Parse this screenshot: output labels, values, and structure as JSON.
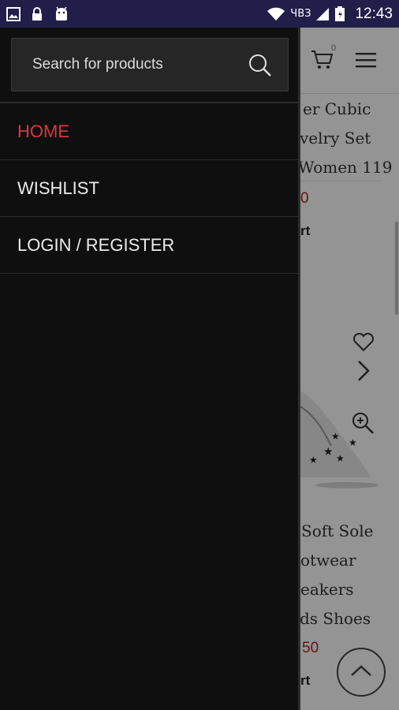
{
  "status_bar": {
    "carrier": "ЧВЗ",
    "time": "12:43",
    "icons": [
      "image-icon",
      "lock-icon",
      "android-icon",
      "wifi-icon",
      "signal-icon",
      "battery-icon"
    ]
  },
  "drawer": {
    "search": {
      "placeholder": "Search for products",
      "value": ""
    },
    "nav": [
      {
        "label": "HOME",
        "active": true
      },
      {
        "label": "WISHLIST",
        "active": false
      },
      {
        "label": "LOGIN / REGISTER",
        "active": false
      }
    ]
  },
  "background": {
    "cart_count": "0",
    "product1_lines": [
      "er Cubic",
      "velry Set",
      "Women 119"
    ],
    "product1_price": "0",
    "product1_cart": "rt",
    "product2_lines": [
      "Soft Sole",
      "otwear",
      "eakers",
      "ds Shoes"
    ],
    "product2_price": "50",
    "product2_cart": "rt"
  },
  "colors": {
    "status_bar": "#221e4a",
    "drawer_bg": "#0f0f0f",
    "active_nav": "#d33a3a",
    "price": "#b21f1f"
  }
}
